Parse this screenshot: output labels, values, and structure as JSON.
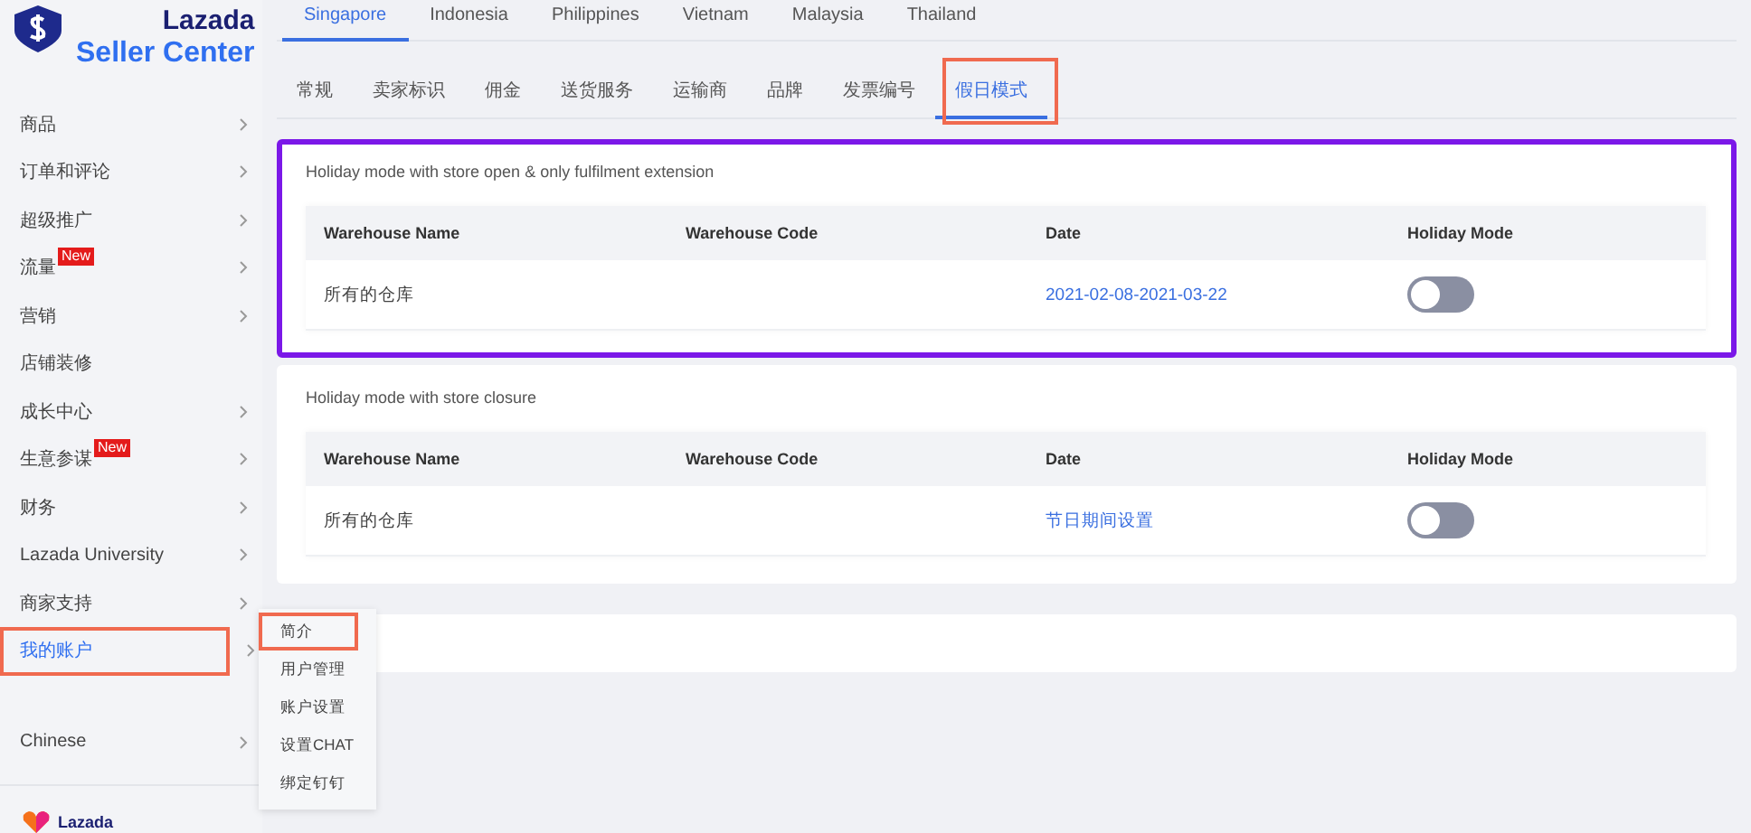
{
  "sidebar": {
    "logo": {
      "brand": "Lazada",
      "subtitle": "Seller Center"
    },
    "items": [
      {
        "label": "商品",
        "arrow": true,
        "selected": false,
        "highlighted": false
      },
      {
        "label": "订单和评论",
        "arrow": true,
        "selected": false,
        "highlighted": false
      },
      {
        "label": "超级推广",
        "arrow": true,
        "selected": false,
        "highlighted": false
      },
      {
        "label": "流量",
        "badge": "New",
        "arrow": true,
        "selected": false,
        "highlighted": false
      },
      {
        "label": "营销",
        "arrow": true,
        "selected": false,
        "highlighted": false
      },
      {
        "label": "店铺装修",
        "arrow": false,
        "selected": false,
        "highlighted": false
      },
      {
        "label": "成长中心",
        "arrow": true,
        "selected": false,
        "highlighted": false
      },
      {
        "label": "生意参谋",
        "badge": "New",
        "arrow": true,
        "selected": false,
        "highlighted": false
      },
      {
        "label": "财务",
        "arrow": true,
        "selected": false,
        "highlighted": false
      },
      {
        "label": "Lazada University",
        "arrow": true,
        "selected": false,
        "highlighted": false
      },
      {
        "label": "商家支持",
        "arrow": true,
        "selected": false,
        "highlighted": false
      },
      {
        "label": "我的账户",
        "arrow": true,
        "selected": true,
        "highlighted": true
      }
    ],
    "language": {
      "label": "Chinese"
    },
    "footer_logo": {
      "text": "Lazada"
    }
  },
  "flyout": {
    "items": [
      {
        "label": "简介",
        "highlighted": true
      },
      {
        "label": "用户管理",
        "highlighted": false
      },
      {
        "label": "账户设置",
        "highlighted": false
      },
      {
        "label": "设置CHAT",
        "highlighted": false
      },
      {
        "label": "绑定钉钉",
        "highlighted": false
      }
    ]
  },
  "country_tabs": [
    {
      "label": "Singapore",
      "selected": true
    },
    {
      "label": "Indonesia",
      "selected": false
    },
    {
      "label": "Philippines",
      "selected": false
    },
    {
      "label": "Vietnam",
      "selected": false
    },
    {
      "label": "Malaysia",
      "selected": false
    },
    {
      "label": "Thailand",
      "selected": false
    }
  ],
  "settings_tabs": [
    {
      "label": "常规",
      "selected": false,
      "highlighted": false
    },
    {
      "label": "卖家标识",
      "selected": false,
      "highlighted": false
    },
    {
      "label": "佣金",
      "selected": false,
      "highlighted": false
    },
    {
      "label": "送货服务",
      "selected": false,
      "highlighted": false
    },
    {
      "label": "运输商",
      "selected": false,
      "highlighted": false
    },
    {
      "label": "品牌",
      "selected": false,
      "highlighted": false
    },
    {
      "label": "发票编号",
      "selected": false,
      "highlighted": false
    },
    {
      "label": "假日模式",
      "selected": true,
      "highlighted": true
    }
  ],
  "sections": [
    {
      "title": "Holiday mode with store open & only fulfilment extension",
      "highlighted": true,
      "columns": [
        "Warehouse Name",
        "Warehouse Code",
        "Date",
        "Holiday Mode"
      ],
      "rows": [
        {
          "name": "所有的仓库",
          "date": "2021-02-08-2021-03-22",
          "on": false
        }
      ]
    },
    {
      "title": "Holiday mode with store closure",
      "highlighted": false,
      "columns": [
        "Warehouse Name",
        "Warehouse Code",
        "Date",
        "Holiday Mode"
      ],
      "rows": [
        {
          "name": "所有的仓库",
          "date": "节日期间设置",
          "on": false
        }
      ]
    }
  ]
}
